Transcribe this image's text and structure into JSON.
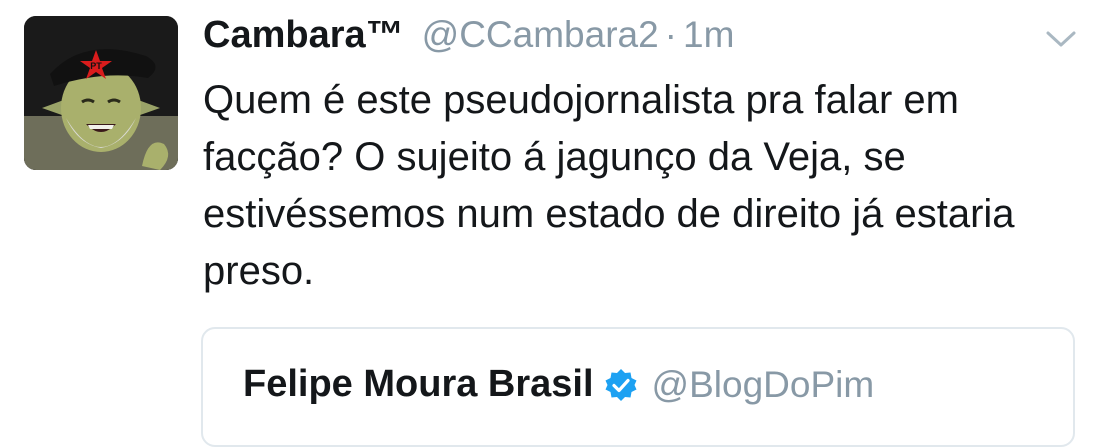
{
  "tweet": {
    "display_name": "Cambara™",
    "handle": "@CCambara2",
    "separator": "·",
    "time": "1m",
    "text": "Quem é este pseudojornalista pra falar em facção? O sujeito á jagunço da Veja, se estivéssemos num estado de direito já estaria preso.",
    "menu_icon": "chevron-down-icon"
  },
  "avatar": {
    "badge_text": "PT"
  },
  "quoted_tweet": {
    "display_name": "Felipe Moura Brasil",
    "verified_icon": "verified-badge-icon",
    "handle": "@BlogDoPim"
  },
  "colors": {
    "text": "#14171a",
    "secondary_text": "#8899a6",
    "border": "#e1e8ed",
    "verified": "#1da1f2"
  }
}
